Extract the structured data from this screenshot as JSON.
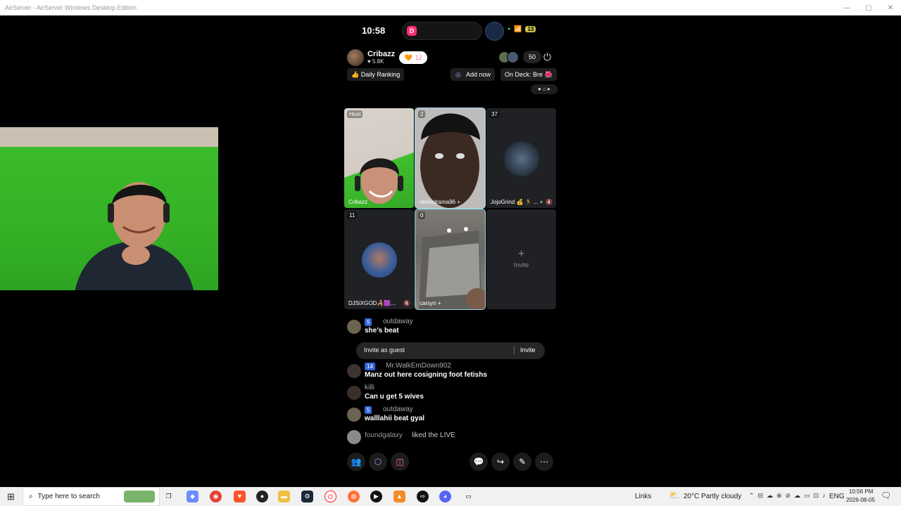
{
  "window": {
    "title": "AirServer - AirServer Windows Desktop Edition",
    "min": "—",
    "max": "▢",
    "close": "✕"
  },
  "phone": {
    "status": {
      "time": "10:58",
      "battery": "13"
    },
    "host": {
      "name": "Cribazz",
      "likes": "♥ 5.8K",
      "hearts": "12"
    },
    "viewer_count": "50",
    "daily_ranking": "👍 Daily Ranking",
    "add_now": "Add now",
    "on_deck": "On Deck: Bre 🌺",
    "tiles": [
      {
        "tag": "Host",
        "name": "Cribazz"
      },
      {
        "tag": "2",
        "name": "remixdrama96 +"
      },
      {
        "tag": "37",
        "name": "JojoGrind 💰 🏃 ... +"
      },
      {
        "tag": "11",
        "name": "DJSiXGOD🦂🟪..."
      },
      {
        "tag": "0",
        "name": "carsyn +"
      },
      {
        "plus": "+",
        "label": "Invite"
      }
    ],
    "invite_guest": {
      "label": "Invite as guest",
      "action": "Invite"
    },
    "chat": [
      {
        "level": "5",
        "user": "outdaway",
        "text": "she’s beat"
      },
      {
        "level": "14",
        "user": "Mr.WalkEmDown902",
        "text": "Manz out here cosigning foot fetishs"
      },
      {
        "user": "killi",
        "text": "Can u get 5 wives"
      },
      {
        "level": "5",
        "user": "outdaway",
        "text": "walllahii beat gyal"
      },
      {
        "user": "foundgalaxy",
        "text": "liked the LIVE"
      }
    ]
  },
  "taskbar": {
    "search_placeholder": "Type here to search",
    "links": "Links",
    "weather": "20°C  Partly cloudy",
    "lang": "ENG",
    "time": "10:56 PM",
    "date": "2026-08-05"
  }
}
